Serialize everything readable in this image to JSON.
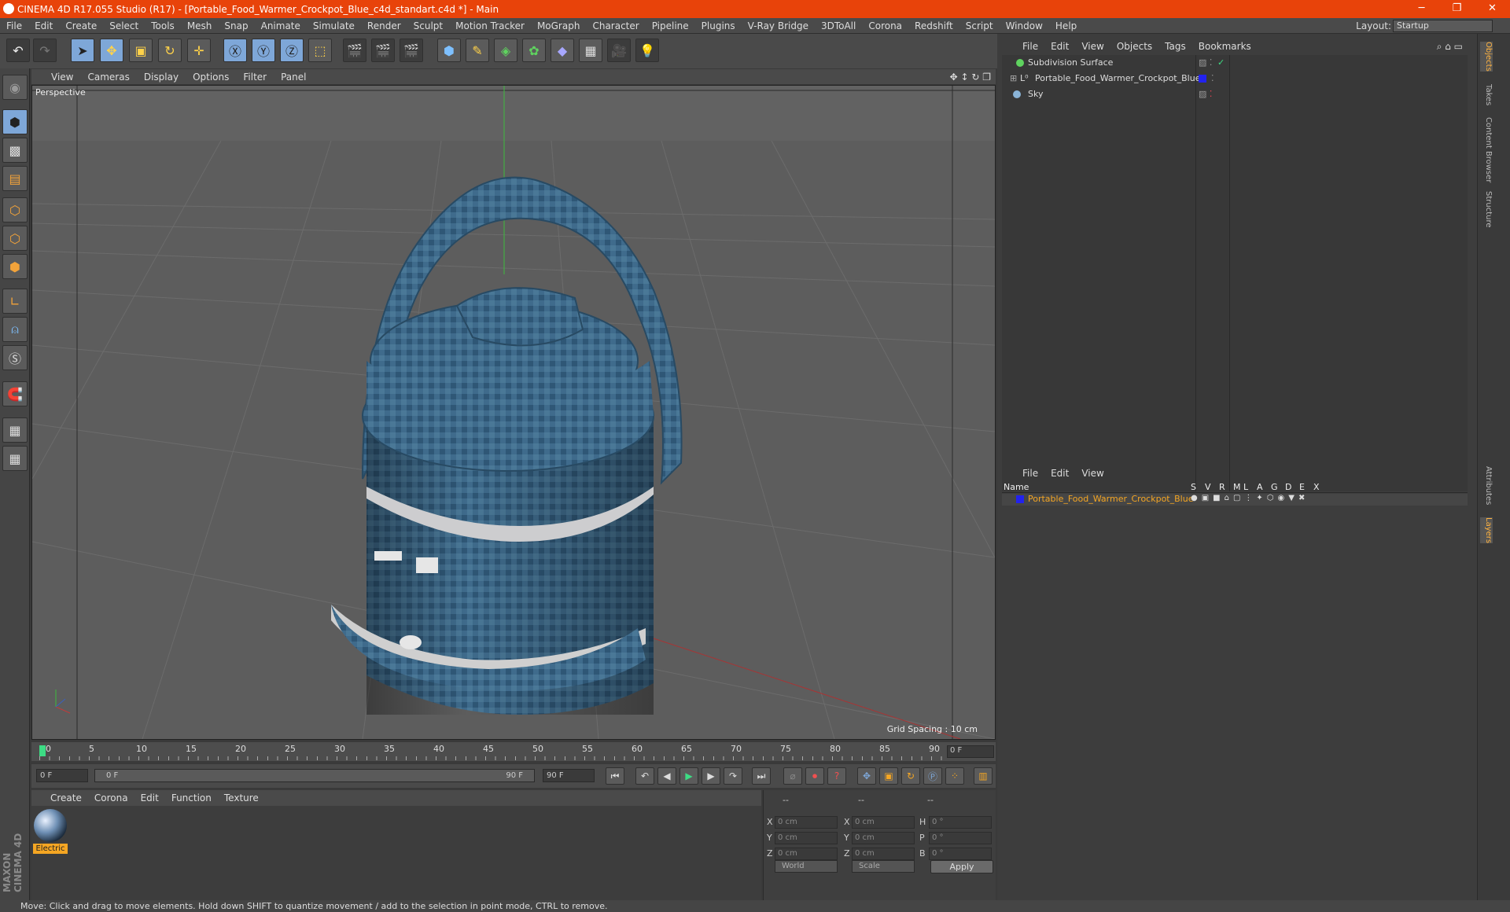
{
  "window": {
    "title": "CINEMA 4D R17.055 Studio (R17) - [Portable_Food_Warmer_Crockpot_Blue_c4d_standart.c4d *] - Main"
  },
  "menu": [
    "File",
    "Edit",
    "Create",
    "Select",
    "Tools",
    "Mesh",
    "Snap",
    "Animate",
    "Simulate",
    "Render",
    "Sculpt",
    "Motion Tracker",
    "MoGraph",
    "Character",
    "Pipeline",
    "Plugins",
    "V-Ray Bridge",
    "3DToAll",
    "Corona",
    "Redshift",
    "Script",
    "Window",
    "Help"
  ],
  "layout": {
    "label": "Layout:",
    "value": "Startup"
  },
  "viewport": {
    "menu": [
      "View",
      "Cameras",
      "Display",
      "Options",
      "Filter",
      "Panel"
    ],
    "label": "Perspective",
    "grid": "Grid Spacing : 10 cm"
  },
  "timeline": {
    "ticks": [
      "0",
      "5",
      "10",
      "15",
      "20",
      "25",
      "30",
      "35",
      "40",
      "45",
      "50",
      "55",
      "60",
      "65",
      "70",
      "75",
      "80",
      "85",
      "90"
    ],
    "current": "0 F"
  },
  "transport": {
    "start": "0 F",
    "range_start": "0 F",
    "range_end": "90 F",
    "end": "90 F"
  },
  "material": {
    "menu": [
      "Create",
      "Corona",
      "Edit",
      "Function",
      "Texture"
    ],
    "name": "Electric"
  },
  "coords": {
    "header": [
      "--",
      "--",
      "--"
    ],
    "rows": [
      {
        "a": "X",
        "av": "0 cm",
        "b": "X",
        "bv": "0 cm",
        "c": "H",
        "cv": "0 °"
      },
      {
        "a": "Y",
        "av": "0 cm",
        "b": "Y",
        "bv": "0 cm",
        "c": "P",
        "cv": "0 °"
      },
      {
        "a": "Z",
        "av": "0 cm",
        "b": "Z",
        "bv": "0 cm",
        "c": "B",
        "cv": "0 °"
      }
    ],
    "world": "World",
    "scale": "Scale",
    "apply": "Apply"
  },
  "objects": {
    "menu": [
      "File",
      "Edit",
      "View",
      "Objects",
      "Tags",
      "Bookmarks"
    ],
    "items": [
      {
        "name": "Subdivision Surface"
      },
      {
        "name": "Portable_Food_Warmer_Crockpot_Blue"
      },
      {
        "name": "Sky"
      }
    ]
  },
  "layers": {
    "menu": [
      "File",
      "Edit",
      "View"
    ],
    "cols": [
      "Name",
      "S",
      "V",
      "R",
      "M",
      "L",
      "A",
      "G",
      "D",
      "E",
      "X"
    ],
    "row": "Portable_Food_Warmer_Crockpot_Blue"
  },
  "right_tabs": [
    "Objects",
    "Takes",
    "Content Browser",
    "Structure",
    "Attributes",
    "Layers"
  ],
  "status": "Move: Click and drag to move elements. Hold down SHIFT to quantize movement / add to the selection in point mode, CTRL to remove.",
  "brand": "MAXON CINEMA 4D",
  "colors": {
    "accent": "#e8430a",
    "object_blue": "#3f6b8c",
    "layer_name": "#f5a623"
  }
}
